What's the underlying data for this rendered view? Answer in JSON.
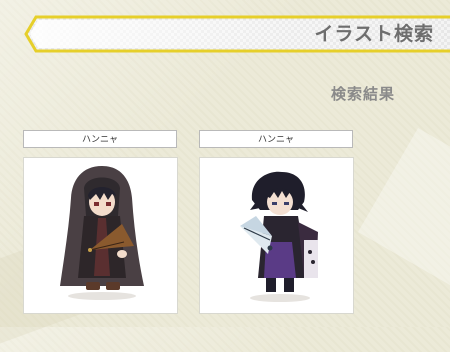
{
  "header": {
    "title": "イラスト検索"
  },
  "results": {
    "heading": "検索結果",
    "items": [
      {
        "label": "ハンニャ",
        "image": "hooded-cloaked-character-with-folding-fan"
      },
      {
        "label": "ハンニャ",
        "image": "dark-haired-character-with-folding-fan-and-purple-robe"
      }
    ]
  },
  "colors": {
    "banner_border": "#e6cf2a",
    "banner_fill": "#f2f2f2",
    "title_text": "#6e6e6e",
    "heading_text": "#8a8a8a",
    "page_background": "#ecead8"
  }
}
